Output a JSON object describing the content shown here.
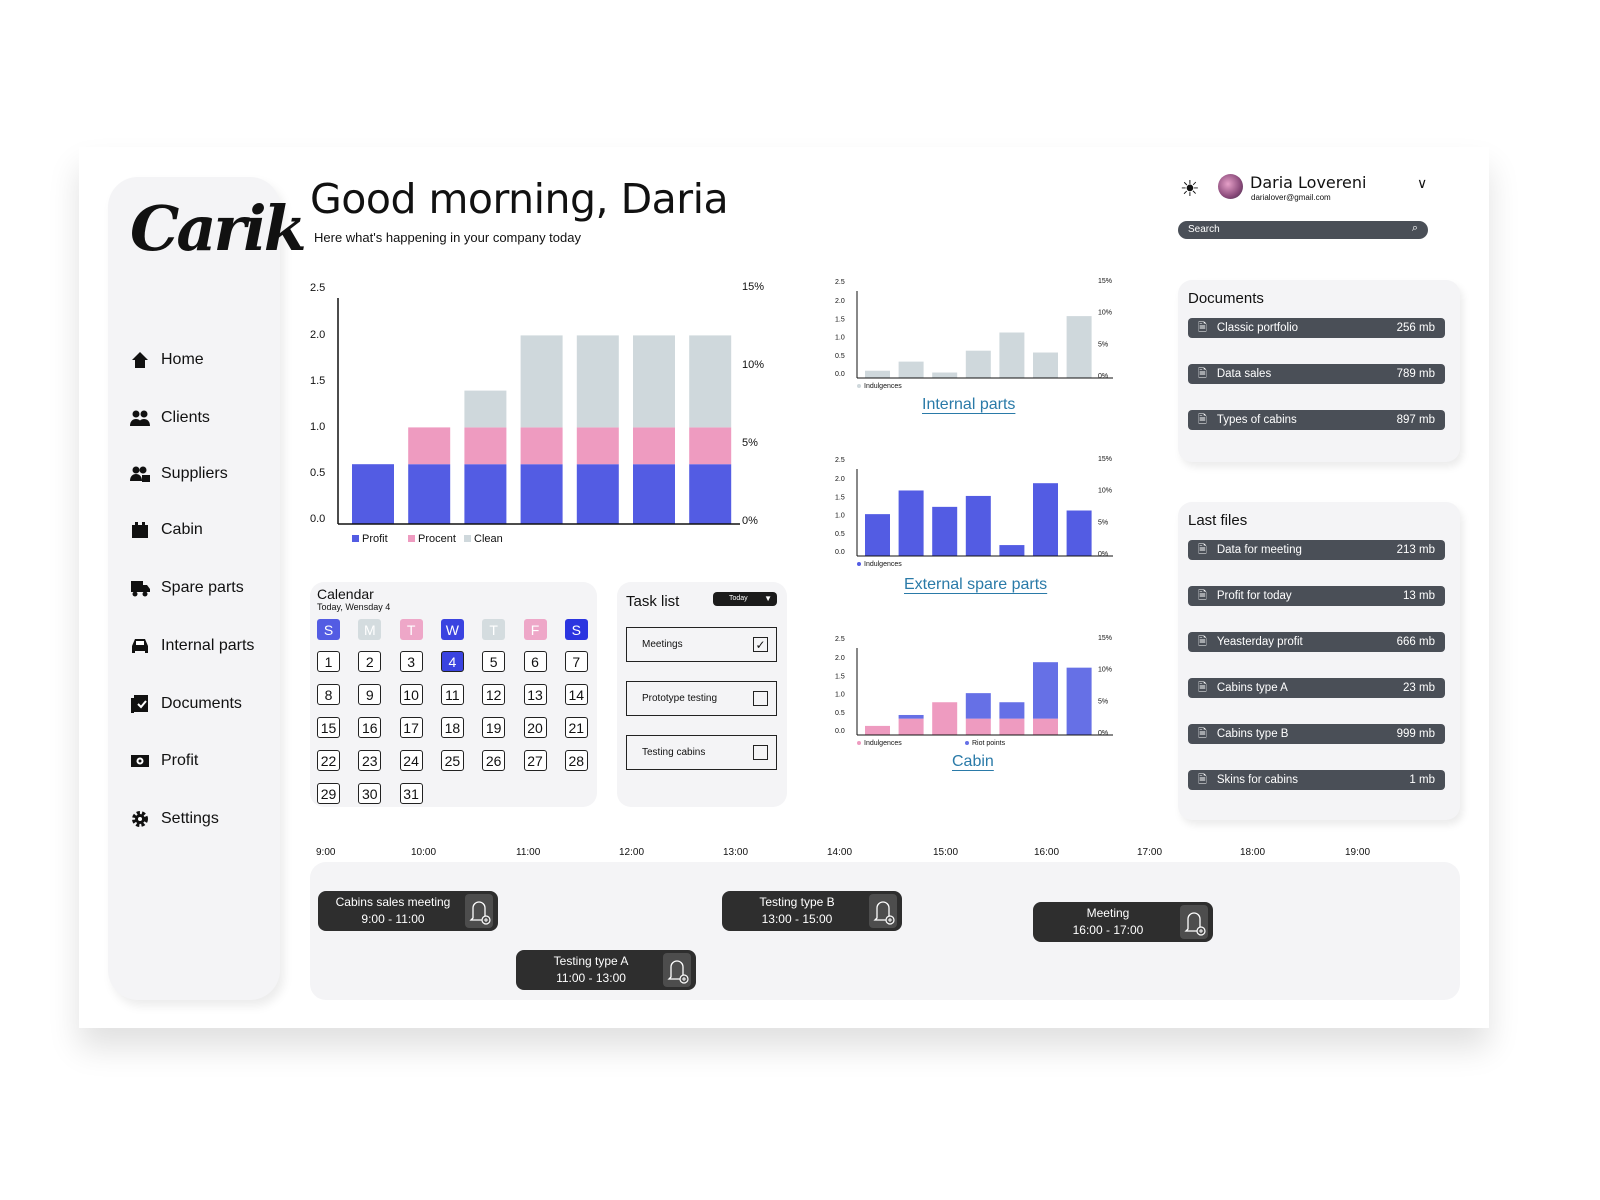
{
  "brand": {
    "logo": "Carik"
  },
  "header": {
    "greeting": "Good morning, Daria",
    "subtitle": "Here what's happening in your company today"
  },
  "user": {
    "name": "Daria Lovereni",
    "email": "darialover@gmail.com",
    "search_placeholder": "Search"
  },
  "sidebar": {
    "items": [
      {
        "label": "Home",
        "icon": "home-icon"
      },
      {
        "label": "Clients",
        "icon": "clients-icon"
      },
      {
        "label": "Suppliers",
        "icon": "suppliers-icon"
      },
      {
        "label": "Cabin",
        "icon": "cabin-icon"
      },
      {
        "label": "Spare parts",
        "icon": "truck-icon"
      },
      {
        "label": "Internal parts",
        "icon": "car-icon"
      },
      {
        "label": "Documents",
        "icon": "documents-icon"
      },
      {
        "label": "Profit",
        "icon": "money-icon"
      },
      {
        "label": "Settings",
        "icon": "gear-icon"
      }
    ]
  },
  "colors": {
    "blue": "#535ce3",
    "pink": "#ee9bc0",
    "grey": "#cfd8dc",
    "dark_blue": "#2b35e0",
    "link": "#2a7aa8"
  },
  "chart_data": [
    {
      "id": "main",
      "type": "bar",
      "stacked": true,
      "ylim": [
        0,
        2.5
      ],
      "yticks": [
        "0.0",
        "0.5",
        "1.0",
        "1.5",
        "2.0",
        "2.5"
      ],
      "y2ticks": [
        "0%",
        "5%",
        "10%",
        "15%"
      ],
      "y2lim": [
        0,
        15
      ],
      "series": [
        {
          "name": "Profit",
          "color": "#535ce3",
          "values": [
            0.65,
            0.65,
            0.65,
            0.65,
            0.65,
            0.65,
            0.65
          ]
        },
        {
          "name": "Procent",
          "color": "#ee9bc0",
          "values": [
            0,
            0.4,
            0.4,
            0.4,
            0.4,
            0.4,
            0.4
          ]
        },
        {
          "name": "Clean",
          "color": "#cfd8dc",
          "values": [
            0,
            0,
            0.4,
            1.0,
            1.0,
            1.0,
            1.0
          ]
        }
      ]
    },
    {
      "id": "internal",
      "title": "Internal parts",
      "type": "bar",
      "ylim": [
        0,
        2.5
      ],
      "yticks": [
        "0.0",
        "0.5",
        "1.0",
        "1.5",
        "2.0",
        "2.5"
      ],
      "y2ticks": [
        "0%",
        "5%",
        "10%",
        "15%"
      ],
      "y2lim": [
        0,
        15
      ],
      "series": [
        {
          "name": "Indulgences",
          "color": "#cfd8dc",
          "values": [
            0.2,
            0.45,
            0.15,
            0.75,
            1.25,
            0.7,
            1.7
          ]
        }
      ]
    },
    {
      "id": "external",
      "title": "External spare parts",
      "type": "bar",
      "ylim": [
        0,
        2.5
      ],
      "yticks": [
        "0.0",
        "0.5",
        "1.0",
        "1.5",
        "2.0",
        "2.5"
      ],
      "y2ticks": [
        "0%",
        "5%",
        "10%",
        "15%"
      ],
      "y2lim": [
        0,
        15
      ],
      "series": [
        {
          "name": "Indulgences",
          "color": "#535ce3",
          "values": [
            1.15,
            1.8,
            1.35,
            1.65,
            0.3,
            2.0,
            1.25
          ]
        }
      ]
    },
    {
      "id": "cabin",
      "title": "Cabin",
      "type": "bar",
      "stacked": true,
      "ylim": [
        0,
        2.5
      ],
      "yticks": [
        "0.0",
        "0.5",
        "1.0",
        "1.5",
        "2.0",
        "2.5"
      ],
      "y2ticks": [
        "0%",
        "5%",
        "10%",
        "15%"
      ],
      "y2lim": [
        0,
        15
      ],
      "series": [
        {
          "name": "Indulgences",
          "color": "#ee9bc0",
          "values": [
            0.25,
            0.45,
            0.9,
            0.45,
            0.45,
            0.45,
            0
          ]
        },
        {
          "name": "Riot points",
          "color": "#6670e6",
          "values": [
            0,
            0.1,
            0,
            0.7,
            0.45,
            1.55,
            1.85
          ]
        }
      ]
    }
  ],
  "calendar": {
    "title": "Calendar",
    "today": "Today, Wensday 4",
    "weekdays": [
      "S",
      "M",
      "T",
      "W",
      "T",
      "F",
      "S"
    ],
    "selected": 4,
    "days": 31
  },
  "tasks": {
    "title": "Task list",
    "filter": "Today",
    "items": [
      {
        "label": "Meetings",
        "checked": true
      },
      {
        "label": "Prototype testing",
        "checked": false
      },
      {
        "label": "Testing cabins",
        "checked": false
      }
    ]
  },
  "documents": {
    "title": "Documents",
    "items": [
      {
        "name": "Classic portfolio",
        "size": "256 mb"
      },
      {
        "name": "Data sales",
        "size": "789 mb"
      },
      {
        "name": "Types of cabins",
        "size": "897 mb"
      }
    ]
  },
  "last_files": {
    "title": "Last files",
    "items": [
      {
        "name": "Data for meeting",
        "size": "213 mb"
      },
      {
        "name": "Profit for today",
        "size": "13 mb"
      },
      {
        "name": "Yeasterday profit",
        "size": "666 mb"
      },
      {
        "name": "Cabins type  A",
        "size": "23 mb"
      },
      {
        "name": "Cabins type B",
        "size": "999 mb"
      },
      {
        "name": "Skins for cabins",
        "size": "1 mb"
      }
    ]
  },
  "timeline": {
    "hours": [
      "9:00",
      "10:00",
      "11:00",
      "12:00",
      "13:00",
      "14:00",
      "15:00",
      "16:00",
      "17:00",
      "18:00",
      "19:00"
    ],
    "events": [
      {
        "title": "Cabins sales meeting",
        "time": "9:00 - 11:00"
      },
      {
        "title": "Testing type A",
        "time": "11:00 - 13:00"
      },
      {
        "title": "Testing type B",
        "time": "13:00 - 15:00"
      },
      {
        "title": "Meeting",
        "time": "16:00 - 17:00"
      }
    ]
  }
}
